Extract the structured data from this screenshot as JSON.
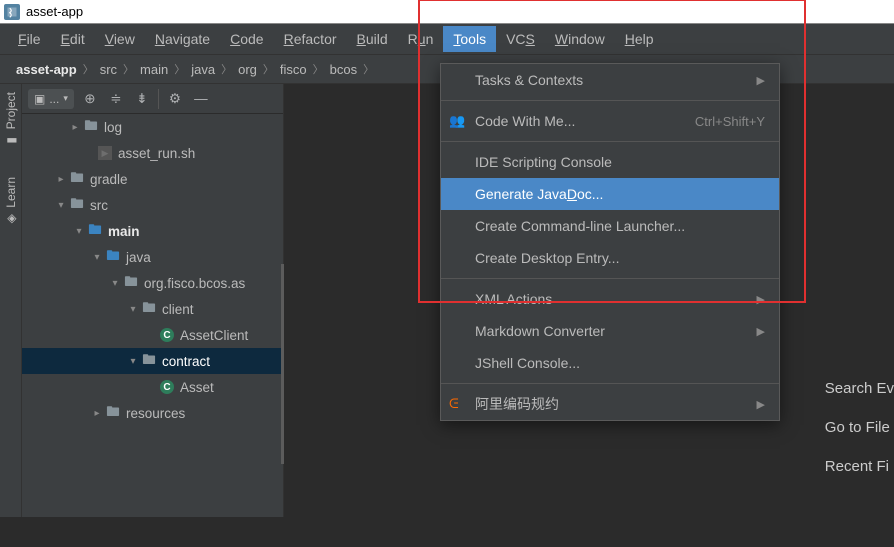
{
  "title": "asset-app",
  "menu": {
    "file": "File",
    "edit": "Edit",
    "view": "View",
    "navigate": "Navigate",
    "code": "Code",
    "refactor": "Refactor",
    "build": "Build",
    "run": "Run",
    "tools": "Tools",
    "vcs": "VCS",
    "window": "Window",
    "help": "Help"
  },
  "breadcrumbs": [
    "asset-app",
    "src",
    "main",
    "java",
    "org",
    "fisco",
    "bcos"
  ],
  "toolbar": {
    "combo": "..."
  },
  "side_tabs": {
    "project": "Project",
    "learn": "Learn"
  },
  "tree": {
    "log": "log",
    "asset_run": "asset_run.sh",
    "gradle": "gradle",
    "src": "src",
    "main": "main",
    "java": "java",
    "pkg": "org.fisco.bcos.as",
    "client": "client",
    "asset_client": "AssetClient",
    "contract": "contract",
    "asset": "Asset",
    "resources": "resources"
  },
  "dropdown": {
    "tasks": "Tasks & Contexts",
    "code_with_me": "Code With Me...",
    "code_with_me_shortcut": "Ctrl+Shift+Y",
    "ide_scripting": "IDE Scripting Console",
    "generate_javadoc": "Generate JavaDoc...",
    "cmd_launcher": "Create Command-line Launcher...",
    "desktop_entry": "Create Desktop Entry...",
    "xml_actions": "XML Actions",
    "markdown": "Markdown Converter",
    "jshell": "JShell Console...",
    "ali": "阿里编码规约"
  },
  "hints": {
    "search": "Search Ev",
    "goto": "Go to File",
    "recent": "Recent Fi"
  }
}
